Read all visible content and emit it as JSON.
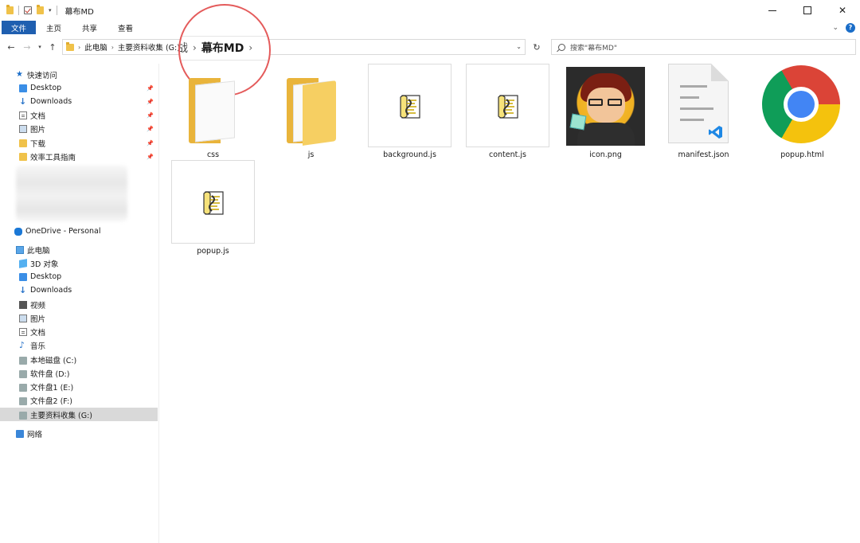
{
  "window": {
    "title": "幕布MD",
    "controls": {
      "minimize": "",
      "maximize": "",
      "close": "✕"
    }
  },
  "ribbon": {
    "tabs": [
      "文件",
      "主页",
      "共享",
      "查看"
    ],
    "help": "?"
  },
  "address": {
    "path": [
      "此电脑",
      "主要资料收集 (G:)"
    ],
    "magnified_prev": "战",
    "magnified_current": "幕布MD"
  },
  "search": {
    "placeholder": "搜索\"幕布MD\""
  },
  "nav": {
    "quick_access": "快速访问",
    "quick_items": [
      "Desktop",
      "Downloads",
      "文档",
      "图片",
      "下载",
      "效率工具指南"
    ],
    "onedrive": "OneDrive - Personal",
    "this_pc": "此电脑",
    "pc_items": [
      "3D 对象",
      "Desktop",
      "Downloads",
      "视频",
      "图片",
      "文档",
      "音乐",
      "本地磁盘 (C:)",
      "软件盘 (D:)",
      "文件盘1 (E:)",
      "文件盘2 (F:)",
      "主要资料收集 (G:)"
    ],
    "network": "网络"
  },
  "files": [
    {
      "name": "css",
      "kind": "folder"
    },
    {
      "name": "js",
      "kind": "folder"
    },
    {
      "name": "background.js",
      "kind": "script"
    },
    {
      "name": "content.js",
      "kind": "script"
    },
    {
      "name": "icon.png",
      "kind": "image"
    },
    {
      "name": "manifest.json",
      "kind": "json"
    },
    {
      "name": "popup.html",
      "kind": "chrome"
    },
    {
      "name": "popup.js",
      "kind": "script"
    }
  ],
  "colors": {
    "accent": "#1f5fb0",
    "highlight_circle": "#e45b5b",
    "selected_bg": "#d9d9d9"
  }
}
